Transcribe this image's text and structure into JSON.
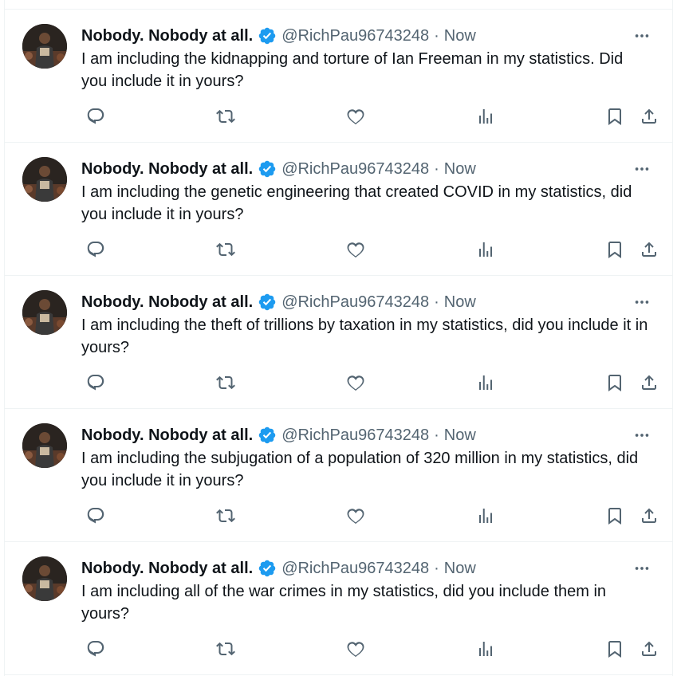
{
  "colors": {
    "verified": "#1d9bf0",
    "text": "#0f1419",
    "muted": "#536471",
    "border": "#eff3f4"
  },
  "icons": [
    "reply-icon",
    "retweet-icon",
    "like-icon",
    "views-icon",
    "bookmark-icon",
    "share-icon",
    "more-icon",
    "verified-badge-icon"
  ],
  "author": {
    "name": "Nobody. Nobody at all.",
    "handle": "@RichPau96743248",
    "separator": "·",
    "time": "Now"
  },
  "tweets": [
    {
      "text": "I am including the kidnapping and torture of Ian Freeman in my statistics. Did you include it in yours?"
    },
    {
      "text": "I am including the genetic engineering that created COVID in my statistics, did you include it in yours?"
    },
    {
      "text": "I am including the theft of trillions by taxation in my statistics, did you include it in yours?"
    },
    {
      "text": "I am including the subjugation of a population of 320 million in my statistics, did you include it in yours?"
    },
    {
      "text": "I am including all of the war crimes in my statistics, did you include them in yours?"
    }
  ]
}
